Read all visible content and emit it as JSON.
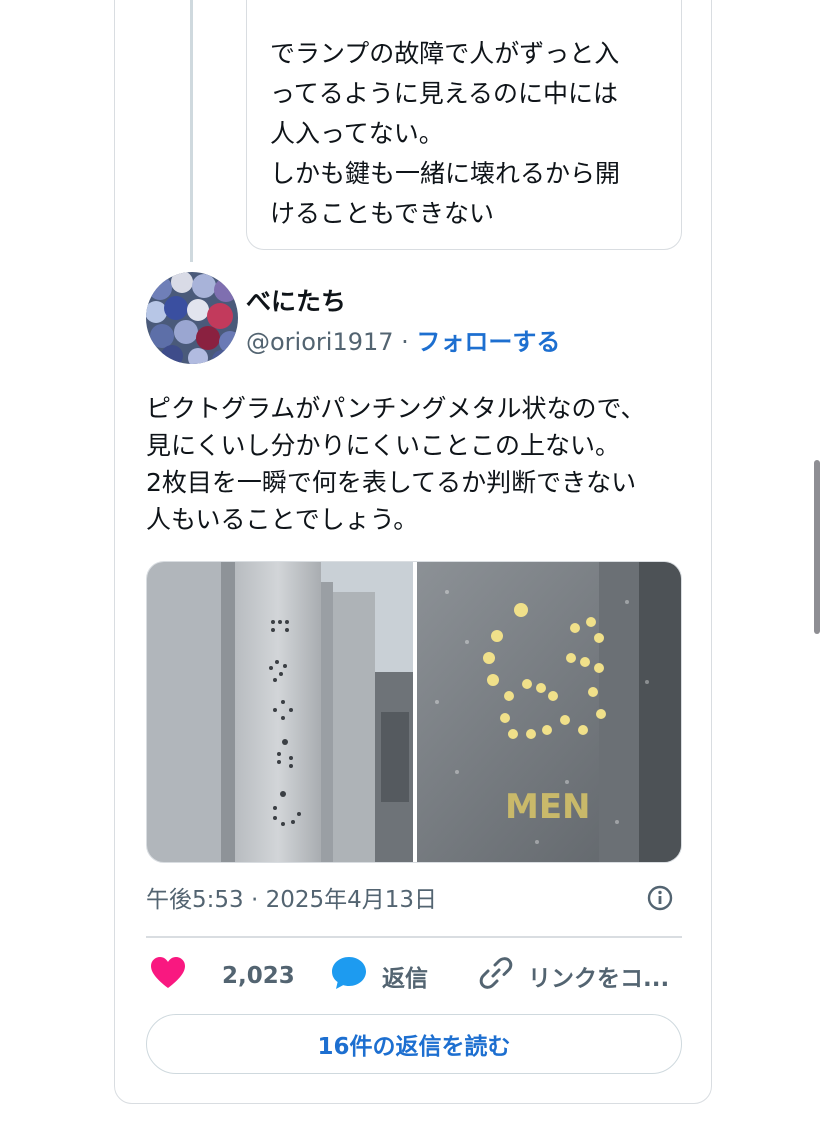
{
  "quoted": {
    "text": "でランプの故障で人がずっと入\nってるように見えるのに中には\n人入ってない。\nしかも鍵も一緒に壊れるから開\nけることもできない"
  },
  "author": {
    "name": "べにたち",
    "handle": "@oriori1917",
    "separator": " · ",
    "follow_label": "フォローする"
  },
  "tweet": {
    "text": "ピクトグラムがパンチングメタル状なので、\n見にくいし分かりにくいことこの上ない。\n2枚目を一瞬で何を表してるか判断できない\n人もいることでしょう。",
    "timestamp": "午後5:53 · 2025年4月13日",
    "image_sign_text": "MEN"
  },
  "actions": {
    "like_count": "2,023",
    "reply_label": "返信",
    "link_label": "リンクをコ..."
  },
  "read_replies_label": "16件の返信を読む",
  "colors": {
    "accent": "#1d6fd0",
    "like": "#f91880",
    "reply_icon": "#1d9bf0",
    "muted": "#536471"
  },
  "icons": [
    "heart-icon",
    "comment-icon",
    "link-icon",
    "info-icon"
  ]
}
